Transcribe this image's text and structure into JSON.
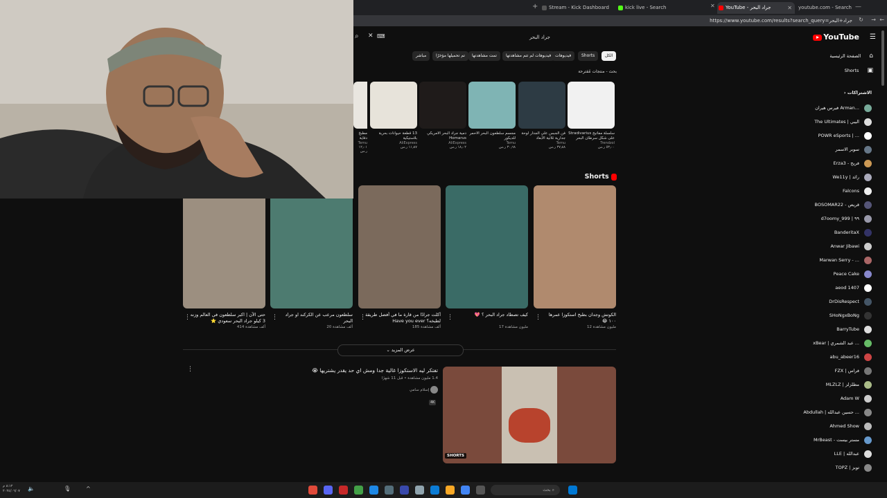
{
  "browser": {
    "tabs": [
      {
        "label": "Stream - Kick Dashboard",
        "fav": "#2b2b2b"
      },
      {
        "label": "kick live - Search",
        "fav": "#53fc18"
      },
      {
        "label": "YouTube - جراد البحر",
        "fav": "#ff0000"
      },
      {
        "label": "youtube.com - Search",
        "fav": "#4285f4"
      }
    ],
    "url": "https://www.youtube.com/results?search_query=جراد+البحر"
  },
  "youtube": {
    "logo": "YouTube",
    "search_value": "جراد البحر",
    "chips": [
      "الكل",
      "Shorts",
      "فيديوهات",
      "فيديوهات لم تتم مشاهدتها",
      "تمت مشاهدتها",
      "تم تحميلها مؤخرًا",
      "مباشر"
    ],
    "nav": {
      "home": "الصفحة الرئيسية",
      "shorts": "Shorts",
      "subs": "الاشتراكات"
    },
    "suggest_heading": "بحث - منتجات مُقترحة",
    "suggestions": [
      {
        "title": "سلسلة مفاتيح Stradivarius على شكل سرطان البحر",
        "store": "Trendzol",
        "price": "٥٣٫٠٠ ر.س",
        "color": "#f1f1f1"
      },
      {
        "title": "فن الجبس على الجدار لوحة جدارية ثلاثية الأبعاد",
        "store": "Temu",
        "price": "٣٧٫٨٨ ر.س",
        "color": "#2d3b44"
      },
      {
        "title": "مجسم سلطعون البحر الأحمر للديكور",
        "store": "Temu",
        "price": "٣٠٫٦٨ ر.س",
        "color": "#7fb4b4"
      },
      {
        "title": "دمية جراد البحر الأمريكي Homarus",
        "store": "AliExpress",
        "price": "١٨٫٠٢ ر.س",
        "color": "#1f1b1a"
      },
      {
        "title": "13 قطعة حيوانات بحرية بلاستيكية",
        "store": "AliExpress",
        "price": "١١٫٨٧ ر.س",
        "color": "#e7e3da"
      },
      {
        "title": "مطبخ دفاية جراد البحر",
        "store": "Temu",
        "price": "١٢٫٠١ ر.س",
        "color": "#e9e6e0"
      }
    ],
    "shorts_heading": "Shorts",
    "shorts": [
      {
        "title": "الكوتش وجدان بطبخ استكوزا عمرها ١٠٠ 😂",
        "views": "12 مليون مشاهدة",
        "color": "#b08a6e"
      },
      {
        "title": "كيف تصطاد جراد البحر ؟ 💖",
        "views": "17 مليون مشاهدة",
        "color": "#3a6b66"
      },
      {
        "title": "أكلت جرادًا من قارة ما في أفضل طريقة لطبخه؟ Have you ever",
        "views": "185 ألف مشاهدة",
        "color": "#7b6a5c"
      },
      {
        "title": "سلطعون مرعب عن الكركند او جراد البحر",
        "views": "20 ألف مشاهدة",
        "color": "#4d7b70"
      },
      {
        "title": "حتى الآن | اكبر سلطعون في العالم وزنه 3 كيلو جراد البحر سعودي ⭐",
        "views": "414 ألف مشاهدة",
        "color": "#9c8f80"
      }
    ],
    "show_more": "عرض المزيد",
    "video": {
      "title": "تفتكر ليه الاستكوزا غالية جدا ومش اي حد يقدر يشتريها 😭",
      "meta": "1.4 مليون مشاهدة • قبل 11 شهرًا",
      "channel": "إسلام سامي",
      "badge": "4K",
      "shorts_label": "SHORTS"
    },
    "subscriptions": [
      "فيرس هيران Arman...",
      "The Ultimates | اليبي",
      "POWR eSports | ...",
      "سوبر الاسمر",
      "Erza3 - فريح",
      "We11y | رائد",
      "Falcons",
      "BOSOMAR22 - قريص",
      "d7oomy_999 | ٩٩",
      "BanderitaX",
      "Anwar Jibawi",
      "Marwan Serry - ...",
      "Peace Cake",
      "aeod 1407",
      "DrDisRespect",
      "SHoNgxBoNg",
      "BarryTube",
      "xBear | عبد الشمري ...",
      "abu_abeer16",
      "FZX | فراس",
      "MLZLZ | مطلزلز",
      "Adam W",
      "Abdullah | حسين عبدالله ...",
      "Ahmed Show",
      "MrBeast - مستر بيست",
      "LLE | عبدالله",
      "TOPZ | توبز"
    ]
  },
  "taskbar": {
    "search": "بحث",
    "time": "٨:١٢ م",
    "date": "٢٠٢٤/٠٦/٠٧"
  },
  "colors": {
    "bg": "#0f0f0f",
    "chip": "#272727",
    "accent": "#ff0000"
  }
}
